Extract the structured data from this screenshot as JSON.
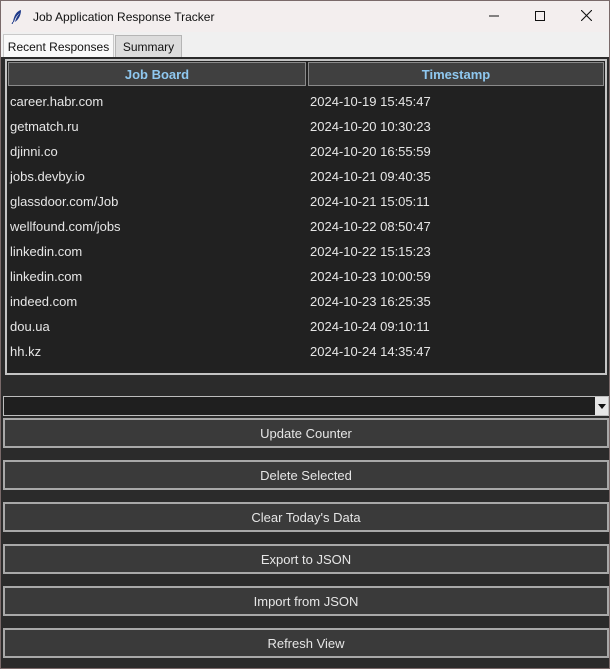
{
  "window": {
    "title": "Job Application Response Tracker"
  },
  "tabs": [
    {
      "label": "Recent Responses",
      "active": true
    },
    {
      "label": "Summary",
      "active": false
    }
  ],
  "table": {
    "columns": [
      "Job Board",
      "Timestamp"
    ],
    "rows": [
      [
        "career.habr.com",
        "2024-10-19 15:45:47"
      ],
      [
        "getmatch.ru",
        "2024-10-20 10:30:23"
      ],
      [
        "djinni.co",
        "2024-10-20 16:55:59"
      ],
      [
        "jobs.devby.io",
        "2024-10-21 09:40:35"
      ],
      [
        "glassdoor.com/Job",
        "2024-10-21 15:05:11"
      ],
      [
        "wellfound.com/jobs",
        "2024-10-22 08:50:47"
      ],
      [
        "linkedin.com",
        "2024-10-22 15:15:23"
      ],
      [
        "linkedin.com",
        "2024-10-23 10:00:59"
      ],
      [
        "indeed.com",
        "2024-10-23 16:25:35"
      ],
      [
        "dou.ua",
        "2024-10-24 09:10:11"
      ],
      [
        "hh.kz",
        "2024-10-24 14:35:47"
      ]
    ]
  },
  "combo": {
    "value": ""
  },
  "buttons": {
    "update": "Update Counter",
    "delete": "Delete Selected",
    "clear": "Clear Today's Data",
    "export": "Export to JSON",
    "import": "Import from JSON",
    "refresh": "Refresh View"
  },
  "icons": {
    "app": "feather-icon",
    "minimize": "minimize-icon",
    "maximize": "maximize-icon",
    "close": "close-icon",
    "dropdown": "chevron-down-icon"
  },
  "colors": {
    "header_text": "#8fc8f0",
    "background": "#2b2b2b",
    "table_bg": "#212121"
  }
}
